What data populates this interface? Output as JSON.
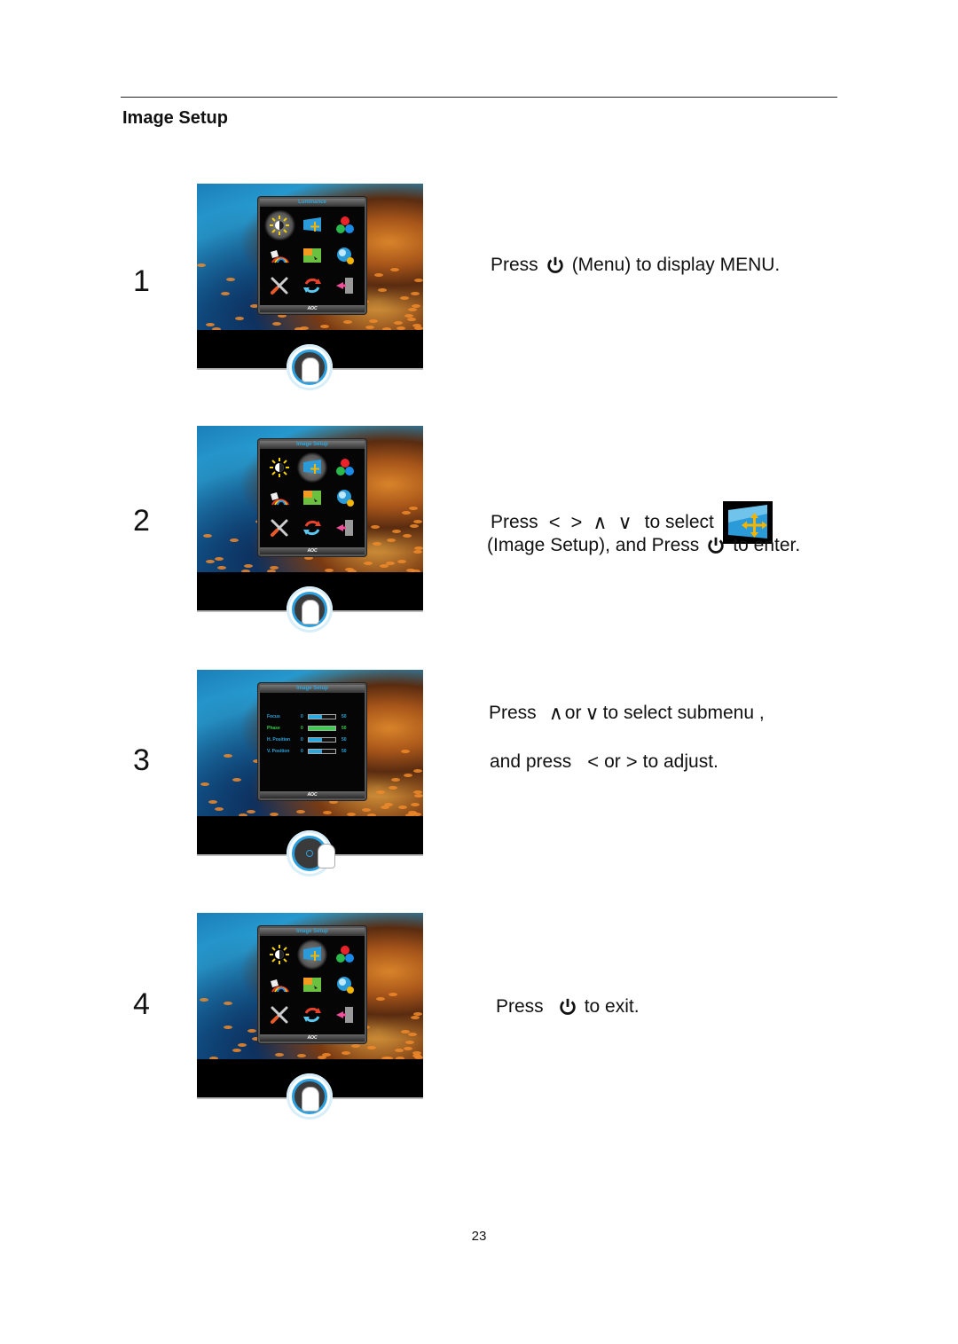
{
  "section": {
    "title": "Image Setup"
  },
  "osd_menu": {
    "brand": "AOC",
    "icons": [
      "luminance-icon",
      "image-setup-icon",
      "color-setup-icon",
      "picture-boost-icon",
      "osd-setup-icon",
      "extra-icon",
      "factory-reset-icon",
      "refresh-icon",
      "exit-icon"
    ]
  },
  "steps": [
    {
      "number": "1",
      "osd_title": "Luminance",
      "selected_icon": 0,
      "instruction": {
        "pre": "Press",
        "post": "(Menu) to  display MENU."
      }
    },
    {
      "number": "2",
      "osd_title": "Image Setup",
      "selected_icon": 1,
      "instruction": {
        "line1_pre": "Press",
        "arrows": [
          "<",
          ">",
          "∧",
          "∨"
        ],
        "line1_post": "to select",
        "line2_pre": "(Image Setup),  and  Press",
        "line2_post": "to enter."
      }
    },
    {
      "number": "3",
      "osd_title": "Image Setup",
      "submenu": [
        {
          "label": "Focus",
          "min": "0",
          "max": "50",
          "value_fraction": 0.5,
          "active": false
        },
        {
          "label": "Phase",
          "min": "0",
          "max": "50",
          "value_fraction": 1.0,
          "active": true
        },
        {
          "label": "H. Position",
          "min": "0",
          "max": "50",
          "value_fraction": 0.5,
          "active": false
        },
        {
          "label": "V. Position",
          "min": "0",
          "max": "50",
          "value_fraction": 0.5,
          "active": false
        }
      ],
      "instruction": {
        "line1_pre": "Press",
        "up": "∧",
        "or1": "or",
        "down": "∨",
        "line1_post": "to select submenu ,",
        "line2_pre": "and press",
        "left": "<",
        "or2": "or",
        "right": ">",
        "line2_post": "to adjust."
      }
    },
    {
      "number": "4",
      "osd_title": "Image Setup",
      "selected_icon": 1,
      "instruction": {
        "pre": "Press",
        "post": "to exit."
      }
    }
  ],
  "footer": {
    "page_number": "23"
  }
}
